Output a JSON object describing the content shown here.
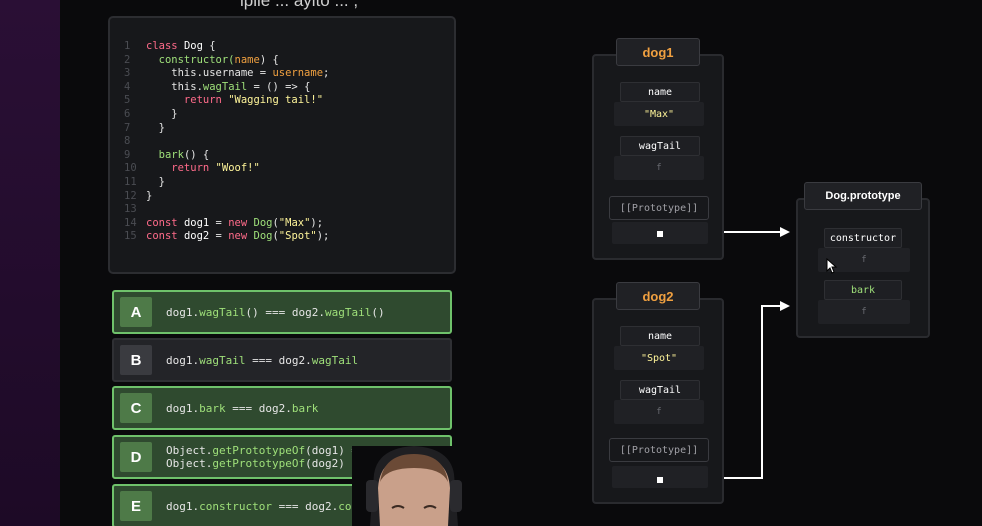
{
  "header": {
    "partial_text": "ipile ... aylto ... ,"
  },
  "code": {
    "lines": [
      [
        {
          "t": "class ",
          "c": "kw"
        },
        {
          "t": "Dog",
          "c": "id"
        },
        {
          "t": " {",
          "c": "pl"
        }
      ],
      [
        {
          "t": "  constructor(",
          "c": "fn"
        },
        {
          "t": "name",
          "c": "prm"
        },
        {
          "t": ") {",
          "c": "pl"
        }
      ],
      [
        {
          "t": "    this.",
          "c": "pl"
        },
        {
          "t": "username",
          "c": "pl"
        },
        {
          "t": " = ",
          "c": "pl"
        },
        {
          "t": "username",
          "c": "prm"
        },
        {
          "t": ";",
          "c": "pl"
        }
      ],
      [
        {
          "t": "    this.",
          "c": "pl"
        },
        {
          "t": "wagTail",
          "c": "fn"
        },
        {
          "t": " = () => {",
          "c": "pl"
        }
      ],
      [
        {
          "t": "      return ",
          "c": "kw"
        },
        {
          "t": "\"Wagging tail!\"",
          "c": "str"
        }
      ],
      [
        {
          "t": "    }",
          "c": "pl"
        }
      ],
      [
        {
          "t": "  }",
          "c": "pl"
        }
      ],
      [
        {
          "t": "",
          "c": "pl"
        }
      ],
      [
        {
          "t": "  bark",
          "c": "fn"
        },
        {
          "t": "() {",
          "c": "pl"
        }
      ],
      [
        {
          "t": "    return ",
          "c": "kw"
        },
        {
          "t": "\"Woof!\"",
          "c": "str"
        }
      ],
      [
        {
          "t": "  }",
          "c": "pl"
        }
      ],
      [
        {
          "t": "}",
          "c": "pl"
        }
      ],
      [
        {
          "t": "",
          "c": "pl"
        }
      ],
      [
        {
          "t": "const ",
          "c": "kw"
        },
        {
          "t": "dog1",
          "c": "id"
        },
        {
          "t": " = ",
          "c": "pl"
        },
        {
          "t": "new ",
          "c": "kw"
        },
        {
          "t": "Dog",
          "c": "fn"
        },
        {
          "t": "(",
          "c": "pl"
        },
        {
          "t": "\"Max\"",
          "c": "str"
        },
        {
          "t": ");",
          "c": "pl"
        }
      ],
      [
        {
          "t": "const ",
          "c": "kw"
        },
        {
          "t": "dog2",
          "c": "id"
        },
        {
          "t": " = ",
          "c": "pl"
        },
        {
          "t": "new ",
          "c": "kw"
        },
        {
          "t": "Dog",
          "c": "fn"
        },
        {
          "t": "(",
          "c": "pl"
        },
        {
          "t": "\"Spot\"",
          "c": "str"
        },
        {
          "t": ");",
          "c": "pl"
        }
      ]
    ]
  },
  "options": [
    {
      "letter": "A",
      "correct": true,
      "lines": [
        [
          {
            "t": "dog1.",
            "c": "pl"
          },
          {
            "t": "wagTail",
            "c": "fn"
          },
          {
            "t": "() === dog2.",
            "c": "pl"
          },
          {
            "t": "wagTail",
            "c": "fn"
          },
          {
            "t": "()",
            "c": "pl"
          }
        ]
      ]
    },
    {
      "letter": "B",
      "correct": false,
      "lines": [
        [
          {
            "t": "dog1.",
            "c": "pl"
          },
          {
            "t": "wagTail",
            "c": "fn"
          },
          {
            "t": " === dog2.",
            "c": "pl"
          },
          {
            "t": "wagTail",
            "c": "fn"
          }
        ]
      ]
    },
    {
      "letter": "C",
      "correct": true,
      "lines": [
        [
          {
            "t": "dog1.",
            "c": "pl"
          },
          {
            "t": "bark",
            "c": "fn"
          },
          {
            "t": " === dog2.",
            "c": "pl"
          },
          {
            "t": "bark",
            "c": "fn"
          }
        ]
      ]
    },
    {
      "letter": "D",
      "correct": true,
      "lines": [
        [
          {
            "t": "Object.",
            "c": "pl"
          },
          {
            "t": "getPrototypeOf",
            "c": "fn"
          },
          {
            "t": "(dog1) ===",
            "c": "pl"
          }
        ],
        [
          {
            "t": "Object.",
            "c": "pl"
          },
          {
            "t": "getPrototypeOf",
            "c": "fn"
          },
          {
            "t": "(dog2)",
            "c": "pl"
          }
        ]
      ]
    },
    {
      "letter": "E",
      "correct": true,
      "lines": [
        [
          {
            "t": "dog1.",
            "c": "pl"
          },
          {
            "t": "constructor",
            "c": "fn"
          },
          {
            "t": " === dog2.",
            "c": "pl"
          },
          {
            "t": "co",
            "c": "fn"
          }
        ]
      ]
    }
  ],
  "dog1": {
    "title": "dog1",
    "name_label": "name",
    "name_value": "\"Max\"",
    "wagtail_label": "wagTail",
    "wagtail_value": "f",
    "proto_label": "[[Prototype]]"
  },
  "dog2": {
    "title": "dog2",
    "name_label": "name",
    "name_value": "\"Spot\"",
    "wagtail_label": "wagTail",
    "wagtail_value": "f",
    "proto_label": "[[Prototype]]"
  },
  "dog_prototype": {
    "title": "Dog.prototype",
    "constructor_label": "constructor",
    "constructor_value": "f",
    "bark_label": "bark",
    "bark_value": "f"
  },
  "colors": {
    "correct_border": "#6fc26b",
    "correct_bg": "#2f4a2f",
    "accent_orange": "#f0a040",
    "string_yellow": "#fff59a",
    "keyword_pink": "#ff6b8a",
    "func_green": "#9fe07a"
  },
  "icons": {
    "cursor": "mouse-pointer-icon"
  }
}
